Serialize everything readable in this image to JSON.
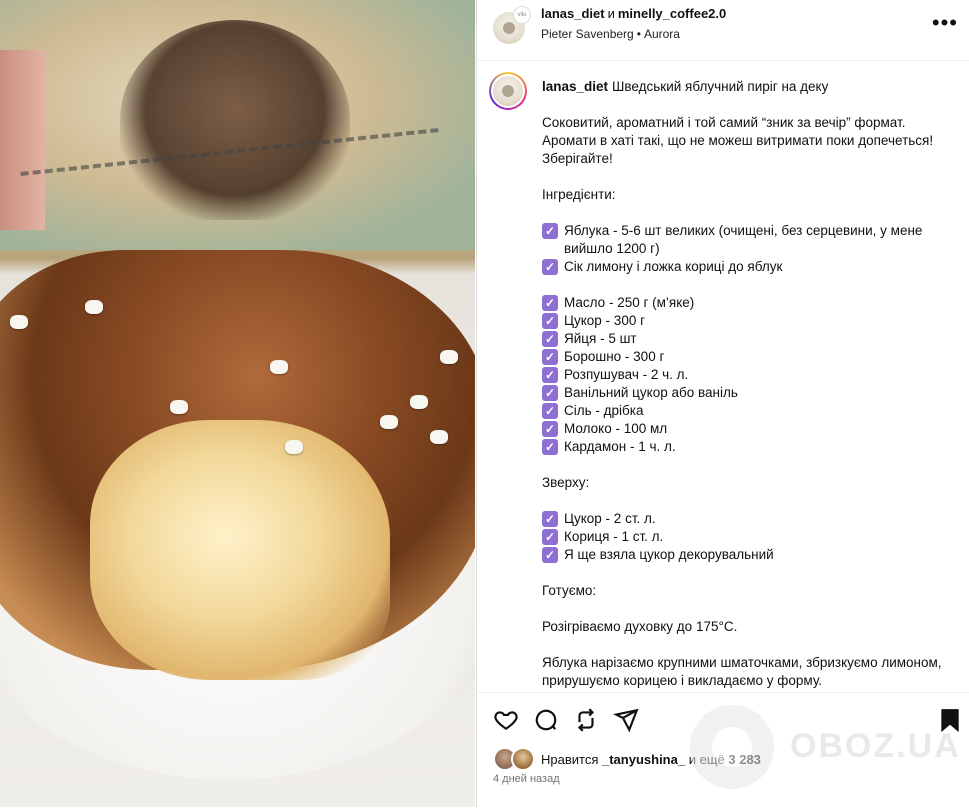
{
  "header": {
    "user1": "lanas_diet",
    "and": "и",
    "user2": "minelly_coffee2.0",
    "audio": "Pieter Savenberg",
    "audio_dot": "•",
    "song": "Aurora",
    "avatar_badge": "vilu",
    "more_label": "•••"
  },
  "caption": {
    "username": "lanas_diet",
    "title": "Шведський яблучний пиріг на деку",
    "intro": "Соковитий, ароматний і той самий “зник за вечір” формат. Аромати в хаті такі, що не можеш витримати поки допечеться! Зберігайте!",
    "ingredients_heading": "Інгредієнти:",
    "ingredients_group1": [
      "Яблука - 5-6 шт великих (очищені, без серцевини, у мене вийшло 1200 г)",
      "Сік лимону і ложка кориці до яблук"
    ],
    "ingredients_group2": [
      "Масло - 250 г (м’яке)",
      "Цукор - 300 г",
      "Яйця - 5 шт",
      "Борошно - 300 г",
      "Розпушувач - 2 ч. л.",
      "Ванільний цукор або ваніль",
      "Сіль - дрібка",
      "Молоко - 100 мл",
      "Кардамон - 1 ч. л."
    ],
    "topping_heading": "Зверху:",
    "topping": [
      "Цукор - 2 ст. л.",
      "Кориця - 1 ст. л.",
      "Я ще взяла цукор декорувальний"
    ],
    "cooking_heading": "Готуємо:",
    "step1": "Розігріваємо духовку до 175°С.",
    "step2": "Яблука нарізаємо крупними шматочками, збризкуємо лимоном, прирушуємо корицею і викладаємо у форму."
  },
  "check_glyph": "✓",
  "likes": {
    "prefix": "Нравится",
    "user": "_tanyushina_",
    "middle": "и ещё",
    "count": "3 283"
  },
  "time": "4 дней назад",
  "watermark": "OBOZ.UA",
  "colors": {
    "check": "#8f6fd1",
    "text": "#111111",
    "muted": "#737373"
  }
}
